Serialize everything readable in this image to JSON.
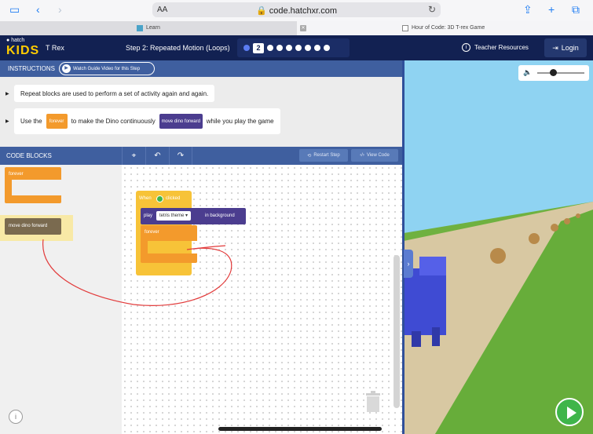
{
  "browser": {
    "text_size_label": "AA",
    "url": "code.hatchxr.com",
    "tabs": [
      {
        "label": "Learn"
      },
      {
        "label": "Hour of Code: 3D T-rex Game"
      }
    ]
  },
  "header": {
    "logo_small": "hatch",
    "logo_big": "KIDS",
    "project_name": "T Rex",
    "step_title": "Step 2: Repeated Motion (Loops)",
    "current_step": "2",
    "teacher_resources": "Teacher Resources",
    "login": "Login"
  },
  "instructions": {
    "label": "INSTRUCTIONS",
    "guide_button": "Watch Guide Video for this Step",
    "line1": "Repeat blocks are used to perform a set of activity again and again.",
    "line2_a": "Use the",
    "line2_block1": "forever",
    "line2_b": "to make the Dino continuously",
    "line2_block2": "move dino forward",
    "line2_c": "while you play the game"
  },
  "code_blocks": {
    "label": "CODE BLOCKS",
    "restart": "Restart Step",
    "view_code": "View Code",
    "palette": {
      "forever": "forever",
      "move": "move dino forward"
    },
    "workspace": {
      "when": "When",
      "clicked": "clicked",
      "play": "play",
      "sound": "tetris theme",
      "in_background": "in background",
      "forever": "forever"
    }
  },
  "colors": {
    "header_navy": "#122152",
    "panel_blue": "#3f5f9f",
    "block_orange": "#f39a2c",
    "block_yellow": "#f7c338",
    "block_purple": "#4b3d8f",
    "play_green": "#3fb54a",
    "annotation_red": "#e23b3b"
  }
}
